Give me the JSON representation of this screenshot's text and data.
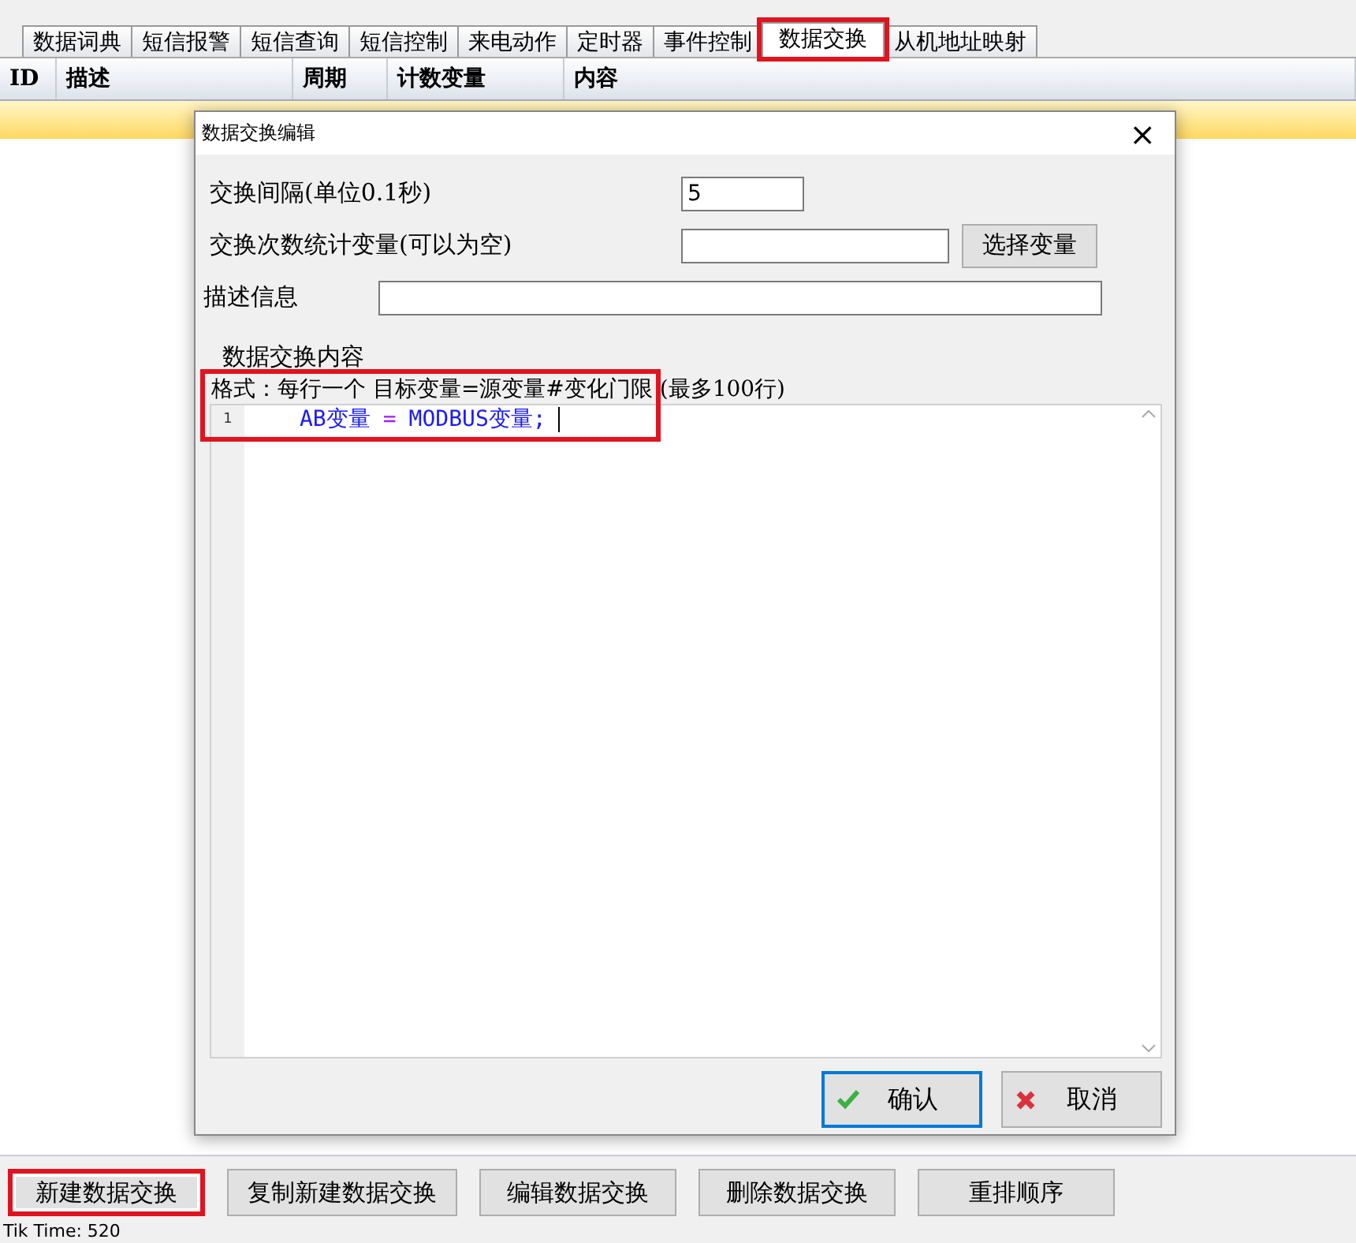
{
  "tabs": [
    {
      "label": "数据词典",
      "selected": false,
      "highlighted": false
    },
    {
      "label": "短信报警",
      "selected": false,
      "highlighted": false
    },
    {
      "label": "短信查询",
      "selected": false,
      "highlighted": false
    },
    {
      "label": "短信控制",
      "selected": false,
      "highlighted": false
    },
    {
      "label": "来电动作",
      "selected": false,
      "highlighted": false
    },
    {
      "label": "定时器",
      "selected": false,
      "highlighted": false
    },
    {
      "label": "事件控制",
      "selected": false,
      "highlighted": false
    },
    {
      "label": "数据交换",
      "selected": true,
      "highlighted": true
    },
    {
      "label": "从机地址映射",
      "selected": false,
      "highlighted": false
    }
  ],
  "table": {
    "columns": [
      "ID",
      "描述",
      "周期",
      "计数变量",
      "内容"
    ],
    "rows": [
      {
        "selected": true
      }
    ]
  },
  "dialog": {
    "title": "数据交换编辑",
    "close": "×",
    "interval": {
      "label": "交换间隔(单位0.1秒)",
      "value": "5"
    },
    "counter": {
      "label": "交换次数统计变量(可以为空)",
      "button": "选择变量"
    },
    "description": {
      "label": "描述信息"
    },
    "group": {
      "title": "数据交换内容",
      "format": "格式：每行一个 目标变量=源变量#变化门限 (最多100行)",
      "highlighted": true,
      "lines": [
        {
          "number": "1",
          "target": "AB变量",
          "op": "=",
          "source": "MODBUS变量;"
        }
      ]
    },
    "ok": "确认",
    "cancel": "取消"
  },
  "buttons": [
    {
      "label": "新建数据交换",
      "highlighted": true
    },
    {
      "label": "复制新建数据交换",
      "highlighted": false
    },
    {
      "label": "编辑数据交换",
      "highlighted": false
    },
    {
      "label": "删除数据交换",
      "highlighted": false
    },
    {
      "label": "重排顺序",
      "highlighted": false
    }
  ],
  "status_bar": "Tik Time: 520"
}
